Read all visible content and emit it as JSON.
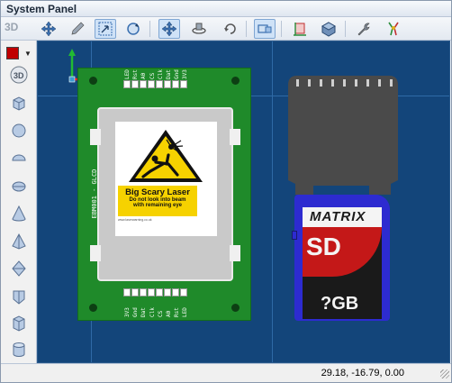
{
  "window": {
    "title": "System Panel"
  },
  "toolbar": {
    "label_3d": "3D",
    "buttons": [
      {
        "name": "move-icon",
        "active": false
      },
      {
        "name": "pencil-icon",
        "active": false
      },
      {
        "name": "select-icon",
        "active": true
      },
      {
        "name": "rotate-icon",
        "active": false
      },
      {
        "name": "pan-icon",
        "active": true
      },
      {
        "name": "orbit-icon",
        "active": false
      },
      {
        "name": "rotate-view-icon",
        "active": false
      },
      {
        "name": "panel-view-icon",
        "active": true
      },
      {
        "name": "axis-view-icon",
        "active": false
      },
      {
        "name": "cube-view-icon",
        "active": false
      },
      {
        "name": "wrench-icon",
        "active": false
      },
      {
        "name": "probe-icon",
        "active": false
      }
    ]
  },
  "sidebar": {
    "color": "#c00000",
    "label_3d": "3D",
    "shapes": [
      "cube-icon",
      "sphere-icon",
      "ellipsoid-icon",
      "flat-ellipsoid-icon",
      "cone-icon",
      "pyramid-icon",
      "diamond-icon",
      "prism-icon",
      "cylinder-hex-icon",
      "cylinder-icon"
    ]
  },
  "pcb": {
    "label": "EBM001 - GLCD",
    "top_pins": [
      "LED",
      "Rst",
      "A0",
      "CS",
      "Clk",
      "Dat",
      "Gnd",
      "3V3"
    ],
    "bottom_pins": [
      "3V3",
      "Gnd",
      "Dat",
      "Clk",
      "CS",
      "A0",
      "Rst",
      "LED"
    ]
  },
  "warning_sign": {
    "title": "Big Scary Laser",
    "line1": "Do not look into beam",
    "line2": "with remaining eye",
    "footer": "www.laserwarning.co.uk"
  },
  "sd_card": {
    "brand": "MATRIX",
    "type": "SD",
    "capacity": "?GB"
  },
  "status": {
    "coords": "29.18, -16.79, 0.00"
  }
}
